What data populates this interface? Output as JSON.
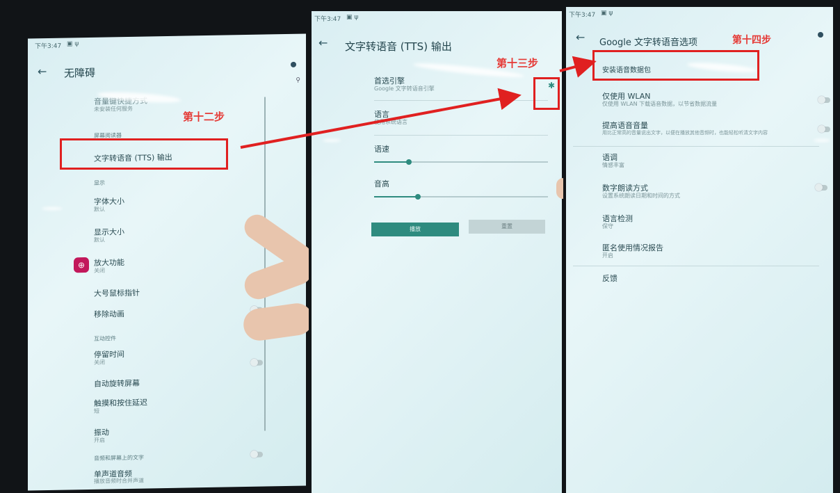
{
  "panel1": {
    "status_time": "下午3:47",
    "title": "无障碍",
    "items": [
      {
        "title": "音量键快捷方式",
        "subtitle": "未安装任何服务"
      },
      {
        "header": "屏幕阅读器"
      },
      {
        "title": "文字转语音 (TTS) 输出"
      },
      {
        "header": "显示"
      },
      {
        "title": "字体大小",
        "subtitle": "默认"
      },
      {
        "title": "显示大小",
        "subtitle": "默认"
      },
      {
        "title": "放大功能",
        "subtitle": "关闭"
      },
      {
        "title": "大号鼠标指针"
      },
      {
        "title": "移除动画"
      },
      {
        "header": "互动控件"
      },
      {
        "title": "停留时间",
        "subtitle": "关闭"
      },
      {
        "title": "自动旋转屏幕"
      },
      {
        "title": "触摸和按住延迟",
        "subtitle": "短"
      },
      {
        "title": "振动",
        "subtitle": "开启"
      },
      {
        "header": "音频和屏幕上的文字"
      },
      {
        "title": "单声道音频",
        "subtitle": "播放音频时合并声道"
      }
    ],
    "step_label": "第十二步"
  },
  "panel2": {
    "status_time": "下午3:47",
    "title": "文字转语音 (TTS) 输出",
    "preferred_engine_title": "首选引擎",
    "preferred_engine_sub": "Google 文字转语音引擎",
    "language_title": "语言",
    "language_sub": "使用系统语言",
    "speech_rate": "语速",
    "pitch": "音高",
    "speech_rate_value": 0.2,
    "pitch_value": 0.25,
    "play_button": "播放",
    "reset_button": "重置",
    "step_label": "第十三步"
  },
  "panel3": {
    "status_time": "下午3:47",
    "title": "Google 文字转语音选项",
    "items": [
      {
        "title": "安装语音数据包"
      },
      {
        "title": "仅使用 WLAN",
        "subtitle": "仅使用 WLAN 下载语音数据，以节省数据流量"
      },
      {
        "title": "提高语音音量",
        "subtitle": "用比正常高的音量说出文字，以便在播放其他音频时，也能轻松听清文字内容"
      },
      {
        "title": "语调",
        "subtitle": "情感丰富"
      },
      {
        "title": "数字朗读方式",
        "subtitle": "设置系统朗读日期和时间的方式"
      },
      {
        "title": "语言检测",
        "subtitle": "保守"
      },
      {
        "title": "匿名使用情况报告",
        "subtitle": "开启"
      },
      {
        "title": "反馈"
      }
    ],
    "step_label": "第十四步"
  }
}
